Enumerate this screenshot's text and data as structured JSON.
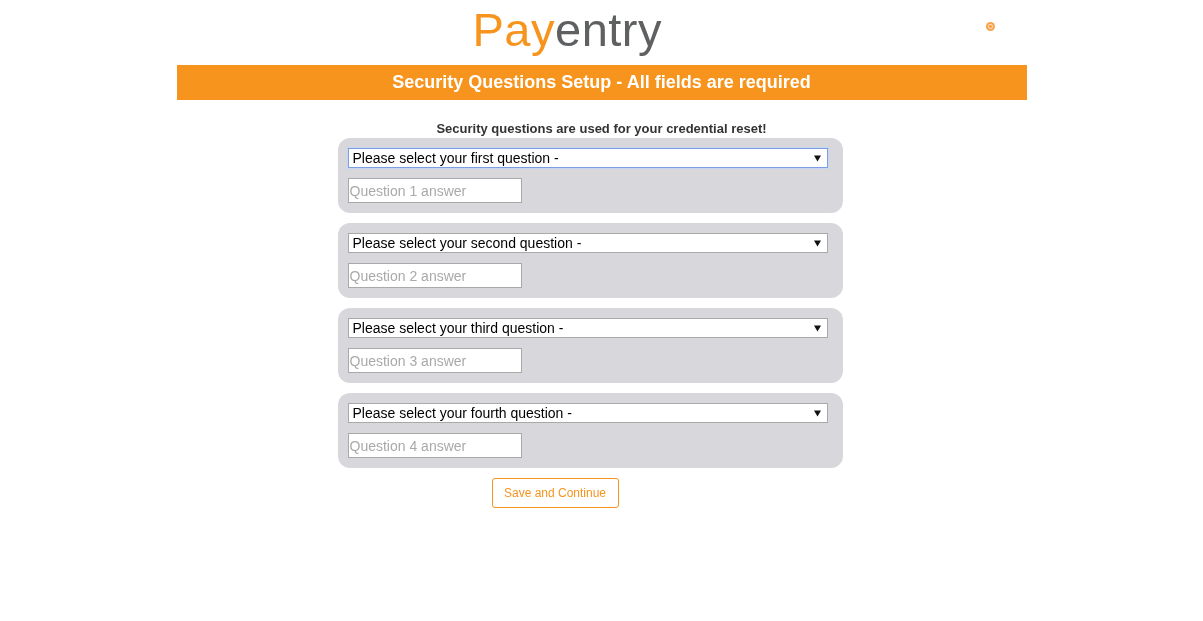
{
  "logo": [
    {
      "text": "Pay",
      "color": "#f7941d"
    },
    {
      "text": "entry",
      "color": "#5f6062"
    }
  ],
  "header": {
    "title": "Security Questions Setup - All fields are required"
  },
  "intro": "Security questions are used for your credential reset!",
  "questions": [
    {
      "question": "Please select your first question -",
      "focused": true,
      "placeholder": "Question 1 answer"
    },
    {
      "question": "Please select your second question -",
      "focused": false,
      "placeholder": "Question 2 answer"
    },
    {
      "question": "Please select your third question -",
      "focused": false,
      "placeholder": "Question 3 answer"
    },
    {
      "question": "Please select your fourth question -",
      "focused": false,
      "placeholder": "Question 4 answer"
    }
  ],
  "buttons": [
    {
      "label": "Save and Continue"
    }
  ]
}
